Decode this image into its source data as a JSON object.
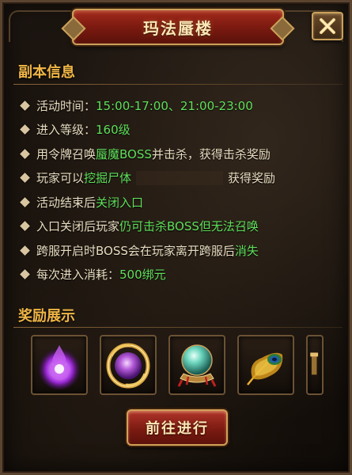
{
  "title": "玛法蜃楼",
  "info_section": {
    "heading": "副本信息",
    "rows": [
      {
        "prefix": "活动时间：",
        "highlight": "15:00-17:00、21:00-23:00",
        "suffix": ""
      },
      {
        "prefix": "进入等级：",
        "highlight": "160级",
        "suffix": ""
      },
      {
        "prefix": "用令牌召唤",
        "highlight": "蜃魔BOSS",
        "suffix": "并击杀，获得击杀奖励"
      },
      {
        "prefix": "玩家可以",
        "highlight": "挖掘尸体",
        "suffix": "获得奖励"
      },
      {
        "prefix": "活动结束后",
        "highlight": "关闭入口",
        "suffix": ""
      },
      {
        "prefix": "入口关闭后玩家",
        "highlight": "仍可击杀BOSS但无法召唤",
        "suffix": ""
      },
      {
        "prefix": "跨服开启时BOSS会在玩家离开跨服后",
        "highlight": "消失",
        "suffix": ""
      },
      {
        "prefix": "每次进入消耗：",
        "highlight": "500绑元",
        "suffix": ""
      }
    ]
  },
  "reward_section": {
    "heading": "奖励展示",
    "items": [
      {
        "icon": "purple-flame-orb-icon"
      },
      {
        "icon": "gold-ring-purple-gem-icon"
      },
      {
        "icon": "crystal-ball-icon"
      },
      {
        "icon": "peacock-feather-icon"
      },
      {
        "icon": "partial-item-icon"
      }
    ]
  },
  "go_button": "前往进行",
  "colors": {
    "heading": "#f0b646",
    "highlight": "#5fe05b",
    "text": "#e8dcc0",
    "banner_red": "#a42a1c",
    "gold_border": "#caa15a"
  }
}
